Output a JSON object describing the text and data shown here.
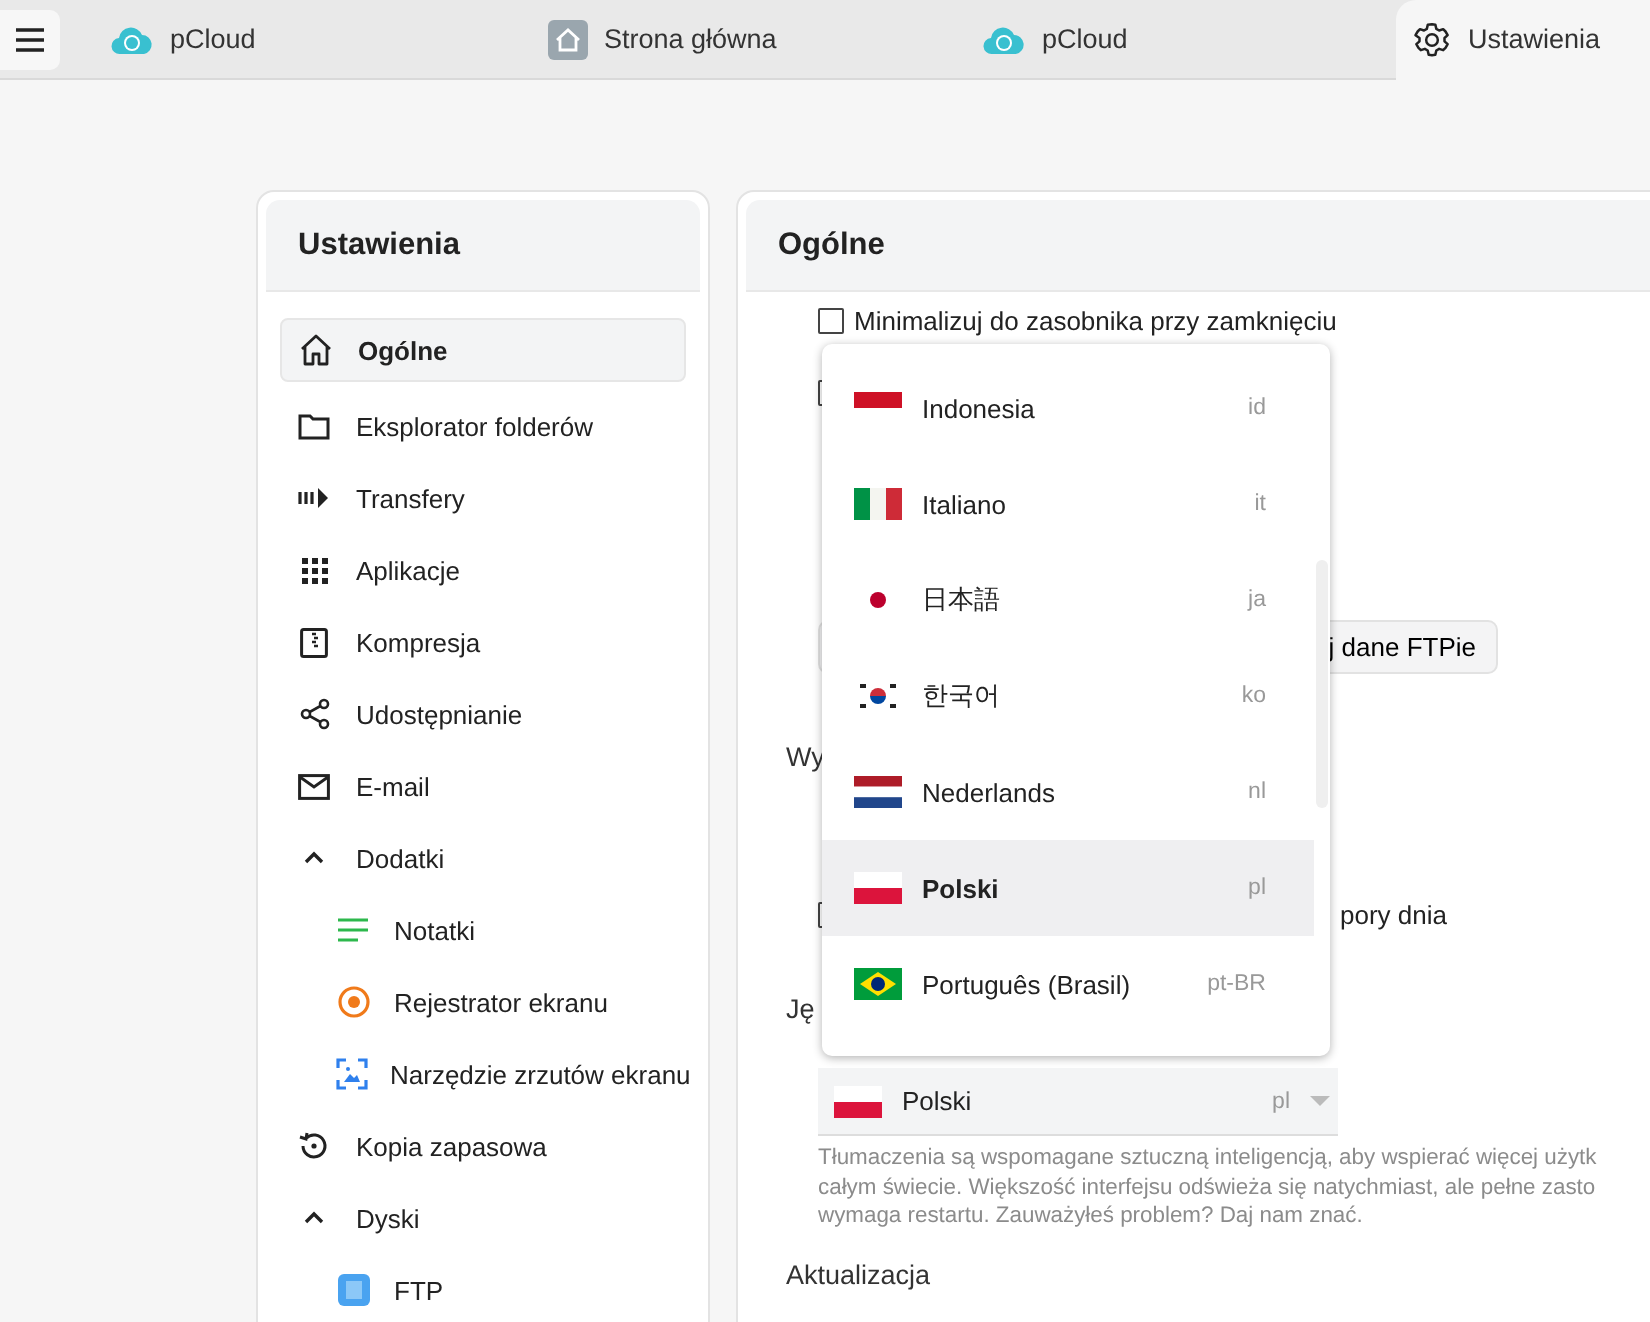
{
  "tabs": [
    {
      "label": "pCloud",
      "selected": false
    },
    {
      "label": "Strona główna",
      "selected": false
    },
    {
      "label": "pCloud",
      "selected": false
    },
    {
      "label": "Ustawienia",
      "selected": true
    }
  ],
  "sidebar": {
    "title": "Ustawienia",
    "items": [
      {
        "label": "Ogólne",
        "selected": true
      },
      {
        "label": "Eksplorator folderów",
        "selected": false
      },
      {
        "label": "Transfery",
        "selected": false
      },
      {
        "label": "Aplikacje",
        "selected": false
      },
      {
        "label": "Kompresja",
        "selected": false
      },
      {
        "label": "Udostępnianie",
        "selected": false
      },
      {
        "label": "E-mail",
        "selected": false
      },
      {
        "label": "Dodatki",
        "selected": false,
        "expanded": true,
        "children": [
          {
            "label": "Notatki",
            "selected": false
          },
          {
            "label": "Rejestrator ekranu",
            "selected": false
          },
          {
            "label": "Narzędzie zrzutów ekranu",
            "selected": false
          }
        ]
      },
      {
        "label": "Kopia zapasowa",
        "selected": false
      },
      {
        "label": "Dyski",
        "selected": false,
        "expanded": true,
        "children": [
          {
            "label": "FTP",
            "selected": false
          }
        ]
      }
    ]
  },
  "main": {
    "title": "Ogólne",
    "rows": [
      {
        "kind": "checkbox",
        "label": "Minimalizuj do zasobnika przy zamknięciu",
        "checked": false
      },
      {
        "kind": "checkbox",
        "checked": false
      },
      {
        "kind": "button",
        "label": "j dane FTPie"
      },
      {
        "kind": "heading",
        "label": "Wy"
      },
      {
        "kind": "checkbox",
        "label": "pory dnia",
        "checked": false
      },
      {
        "kind": "heading",
        "label": "Ję"
      },
      {
        "kind": "select",
        "value": "Polski",
        "code": "pl"
      },
      {
        "kind": "note",
        "lines": [
          "Tłumaczenia są wspomagane sztuczną inteligencją, aby wspierać więcej użytk",
          "całym świecie. Większość interfejsu odświeża się natychmiast, ale pełne zasto",
          "wymaga restartu. Zauważyłeś problem? Daj nam znać."
        ]
      },
      {
        "kind": "heading",
        "label": "Aktualizacja"
      }
    ],
    "language_menu": {
      "options": [
        {
          "label": "Indonesia",
          "code": "id",
          "selected": false
        },
        {
          "label": "Italiano",
          "code": "it",
          "selected": false
        },
        {
          "label": "日本語",
          "code": "ja",
          "selected": false
        },
        {
          "label": "한국어",
          "code": "ko",
          "selected": false
        },
        {
          "label": "Nederlands",
          "code": "nl",
          "selected": false
        },
        {
          "label": "Polski",
          "code": "pl",
          "selected": true
        },
        {
          "label": "Português (Brasil)",
          "code": "pt-BR",
          "selected": false
        }
      ]
    }
  }
}
